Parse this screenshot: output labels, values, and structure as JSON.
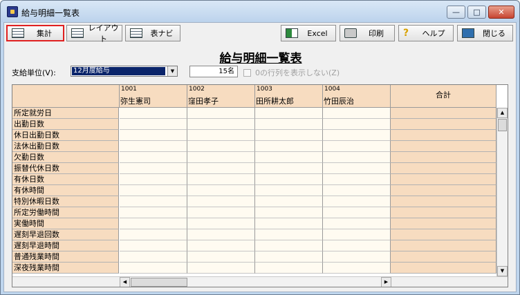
{
  "window": {
    "title": "給与明細一覧表",
    "controls": {
      "minimize": "—",
      "maximize": "□",
      "close": "✕"
    }
  },
  "toolbar": {
    "aggregate_label": "集計",
    "layout_label": "レイアウト",
    "table_navi_label": "表ナビ",
    "excel_label": "Excel",
    "print_label": "印刷",
    "help_label": "ヘルプ",
    "close_label": "閉じる",
    "help_icon": "?"
  },
  "report": {
    "title": "給与明細一覧表",
    "unit_label": "支給単位(V):",
    "unit_value": "12月度給与",
    "count_value": "15名",
    "hide_zero_label": "0の行列を表示しない(Z)"
  },
  "grid": {
    "columns": [
      {
        "code": "1001",
        "name": "弥生憲司"
      },
      {
        "code": "1002",
        "name": "窪田孝子"
      },
      {
        "code": "1003",
        "name": "田所耕太郎"
      },
      {
        "code": "1004",
        "name": "竹田辰治"
      }
    ],
    "total_label": "合計",
    "rows": [
      "所定就労日",
      "出勤日数",
      "休日出勤日数",
      "法休出勤日数",
      "欠勤日数",
      "振替代休日数",
      "有休日数",
      "有休時間",
      "特別休暇日数",
      "所定労働時間",
      "実働時間",
      "遅刻早退回数",
      "遅刻早退時間",
      "普通残業時間",
      "深夜残業時間"
    ]
  },
  "scroll": {
    "up": "▲",
    "down": "▼",
    "left": "◀",
    "right": "▶"
  },
  "select_arrow": "▼"
}
